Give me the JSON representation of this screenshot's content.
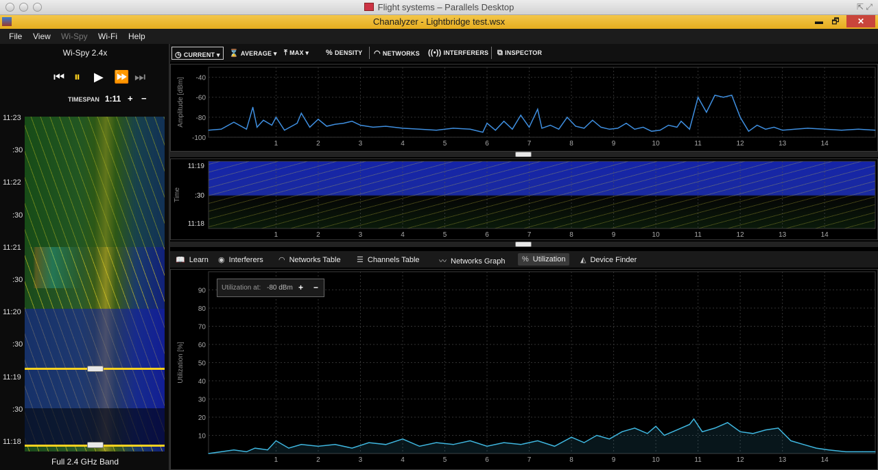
{
  "mac_window": {
    "title": "Flight systems – Parallels Desktop"
  },
  "app_window": {
    "title": "Chanalyzer - Lightbridge test.wsx",
    "minimize": "▬",
    "restore": "🗗",
    "close": "✕"
  },
  "menu": [
    "File",
    "View",
    "Wi-Spy",
    "Wi-Fi",
    "Help"
  ],
  "device": {
    "name": "Wi-Spy 2.4x",
    "timespan_label": "TIMESPAN",
    "timespan_value": "1:11",
    "plus": "+",
    "minus": "−",
    "band_label": "Full 2.4 GHz Band",
    "waterfall_ticks": [
      "11:23",
      ":30",
      "11:22",
      ":30",
      "11:21",
      ":30",
      "11:20",
      ":30",
      "11:19",
      ":30",
      "11:18"
    ]
  },
  "toolbar": {
    "current": "CURRENT",
    "average": "AVERAGE",
    "max": "MAX",
    "density": "DENSITY",
    "networks": "NETWORKS",
    "interferers": "INTERFERERS",
    "inspector": "INSPECTOR"
  },
  "tabs": {
    "learn": "Learn",
    "interferers": "Interferers",
    "networks_table": "Networks Table",
    "channels_table": "Channels Table",
    "networks_graph": "Networks Graph",
    "utilization": "Utilization",
    "device_finder": "Device Finder"
  },
  "utilization_control": {
    "label": "Utilization at:",
    "value": "-80 dBm",
    "plus": "+",
    "minus": "−"
  },
  "colors": {
    "trace": "#3f8fe0",
    "util": "#3fb7e0",
    "accent": "#ffd21f",
    "grid": "#333333"
  },
  "chart_data": [
    {
      "type": "line",
      "ylabel": "Amplitude [dBm]",
      "ylim": [
        -100,
        -30
      ],
      "yticks": [
        "-40",
        "-60",
        "-80",
        "-100"
      ],
      "xlim": [
        -0.6,
        15.2
      ],
      "xticks": [
        "1",
        "2",
        "3",
        "4",
        "5",
        "6",
        "7",
        "8",
        "9",
        "10",
        "11",
        "12",
        "13",
        "14"
      ],
      "x": [
        -0.6,
        -0.3,
        0,
        0.3,
        0.45,
        0.55,
        0.7,
        0.9,
        1.0,
        1.2,
        1.5,
        1.6,
        1.8,
        2.0,
        2.2,
        2.4,
        2.6,
        2.8,
        3.0,
        3.3,
        3.6,
        4.0,
        4.4,
        4.8,
        5.2,
        5.6,
        5.9,
        6.0,
        6.2,
        6.4,
        6.6,
        6.8,
        7.0,
        7.2,
        7.3,
        7.5,
        7.7,
        7.9,
        8.1,
        8.3,
        8.5,
        8.7,
        8.9,
        9.1,
        9.3,
        9.5,
        9.7,
        9.9,
        10.1,
        10.3,
        10.5,
        10.6,
        10.8,
        11.0,
        11.2,
        11.4,
        11.6,
        11.8,
        12.0,
        12.2,
        12.4,
        12.6,
        12.8,
        13.0,
        13.3,
        13.6,
        14.0,
        14.4,
        14.8,
        15.2
      ],
      "y": [
        -93,
        -92,
        -85,
        -92,
        -70,
        -90,
        -83,
        -88,
        -80,
        -93,
        -86,
        -76,
        -90,
        -82,
        -89,
        -87,
        -86,
        -84,
        -88,
        -90,
        -89,
        -91,
        -92,
        -93,
        -91,
        -92,
        -95,
        -86,
        -93,
        -84,
        -92,
        -78,
        -90,
        -72,
        -91,
        -88,
        -92,
        -80,
        -89,
        -91,
        -83,
        -90,
        -92,
        -91,
        -86,
        -92,
        -90,
        -94,
        -93,
        -88,
        -90,
        -84,
        -92,
        -60,
        -75,
        -58,
        -60,
        -58,
        -80,
        -94,
        -88,
        -92,
        -90,
        -93,
        -92,
        -91,
        -92,
        -93,
        -92,
        -93
      ]
    },
    {
      "type": "heatmap",
      "ylabel": "Time",
      "yticks": [
        "11:19",
        ":30",
        "11:18"
      ],
      "xticks": [
        "1",
        "2",
        "3",
        "4",
        "5",
        "6",
        "7",
        "8",
        "9",
        "10",
        "11",
        "12",
        "13",
        "14"
      ]
    },
    {
      "type": "line",
      "ylabel": "Utilization [%]",
      "ylim": [
        0,
        100
      ],
      "yticks": [
        "90",
        "80",
        "70",
        "60",
        "50",
        "40",
        "30",
        "20",
        "10"
      ],
      "xlim": [
        -0.6,
        15.2
      ],
      "xticks": [
        "1",
        "2",
        "3",
        "4",
        "5",
        "6",
        "7",
        "8",
        "9",
        "10",
        "11",
        "12",
        "13",
        "14"
      ],
      "x": [
        -0.6,
        -0.3,
        0,
        0.3,
        0.5,
        0.8,
        1.0,
        1.3,
        1.6,
        2.0,
        2.4,
        2.8,
        3.2,
        3.6,
        4.0,
        4.4,
        4.8,
        5.2,
        5.6,
        6.0,
        6.4,
        6.8,
        7.2,
        7.6,
        8.0,
        8.3,
        8.6,
        8.9,
        9.2,
        9.5,
        9.8,
        10.0,
        10.2,
        10.5,
        10.8,
        10.9,
        11.1,
        11.4,
        11.7,
        12.0,
        12.3,
        12.6,
        12.9,
        13.2,
        13.5,
        13.8,
        14.1,
        14.5,
        14.9,
        15.2
      ],
      "y": [
        0,
        1,
        2,
        1,
        3,
        2,
        7,
        3,
        5,
        4,
        5,
        3,
        6,
        5,
        8,
        4,
        6,
        5,
        7,
        4,
        6,
        5,
        7,
        4,
        9,
        6,
        10,
        8,
        12,
        14,
        11,
        15,
        10,
        13,
        16,
        19,
        12,
        14,
        17,
        12,
        11,
        13,
        14,
        7,
        5,
        3,
        2,
        1,
        1,
        1
      ]
    }
  ]
}
